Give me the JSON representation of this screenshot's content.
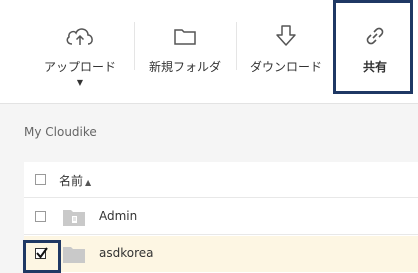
{
  "toolbar": {
    "upload_label": "アップロード",
    "newfolder_label": "新規フォルダ",
    "download_label": "ダウンロード",
    "share_label": "共有",
    "upload_caret": "▼"
  },
  "breadcrumb": {
    "text": "My Cloudike"
  },
  "table": {
    "header": {
      "name_label": "名前",
      "sort_indicator": "▲"
    },
    "rows": [
      {
        "name": "Admin",
        "icon": "shared-folder-icon",
        "checked": false
      },
      {
        "name": "asdkorea",
        "icon": "folder-icon",
        "checked": true
      }
    ]
  },
  "colors": {
    "highlight": "#1f3864",
    "selected_row": "#fdf6e3",
    "background": "#f5f5f5"
  }
}
